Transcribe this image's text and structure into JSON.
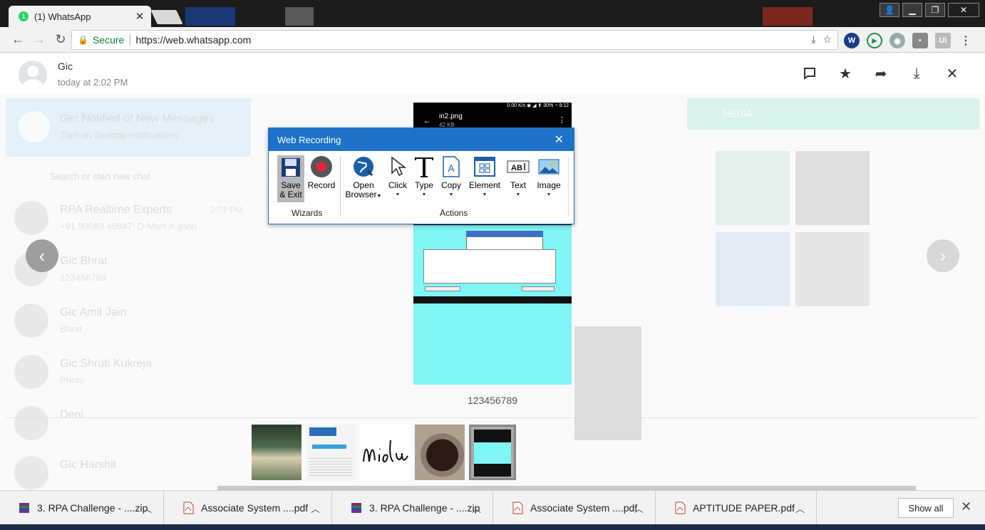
{
  "browser": {
    "tab_title": "(1) WhatsApp",
    "tab_badge": "1",
    "secure_label": "Secure",
    "url": "https://web.whatsapp.com"
  },
  "viewer": {
    "sender_name": "Gic",
    "sender_time": "today at 2:02 PM",
    "caption": "123456789"
  },
  "phone_image": {
    "status": "0.00 K/s ◉ ◢ ⬆ 30% ◔ 9:12",
    "file_name": "in2.png",
    "file_size": "42 KB"
  },
  "background_chats": {
    "notify_title": "Get Notified of New Messages",
    "notify_sub": "Turn on desktop notifications",
    "search_placeholder": "Search or start new chat",
    "chats": [
      {
        "name": "RPA Realtime Experts",
        "msg": "+91 90083 46847: D-Mart is givin...",
        "time": "2:?? PM"
      },
      {
        "name": "Gic Bhrat",
        "msg": "123456789",
        "time": ""
      },
      {
        "name": "Gic Amit Jain",
        "msg": "Bhrat",
        "time": ""
      },
      {
        "name": "Gic Shruti Kukreja",
        "msg": "Photo",
        "time": ""
      },
      {
        "name": "Deni",
        "msg": "",
        "time": ""
      },
      {
        "name": "Gic Harshit",
        "msg": "",
        "time": ""
      }
    ],
    "media_tab": "MEDIA"
  },
  "dialog": {
    "title": "Web Recording",
    "wizards_label": "Wizards",
    "actions_label": "Actions",
    "save_label_1": "Save",
    "save_label_2": "& Exit",
    "record_label": "Record",
    "open_browser_1": "Open",
    "open_browser_2": "Browser",
    "click_label": "Click",
    "type_label": "Type",
    "copy_label": "Copy",
    "element_label": "Element",
    "text_label": "Text",
    "image_label": "Image"
  },
  "downloads": [
    {
      "name": "3. RPA Challenge - ....zip",
      "kind": "zip"
    },
    {
      "name": "Associate System ....pdf",
      "kind": "pdf"
    },
    {
      "name": "3. RPA Challenge - ....zip",
      "kind": "zip"
    },
    {
      "name": "Associate System ....pdf",
      "kind": "pdf"
    },
    {
      "name": "APTITUDE PAPER.pdf",
      "kind": "pdf"
    }
  ],
  "show_all_label": "Show all",
  "colors": {
    "dialog_blue": "#1e73c8",
    "whatsapp_green": "#25d366",
    "phone_cyan": "#7ff5f5"
  }
}
